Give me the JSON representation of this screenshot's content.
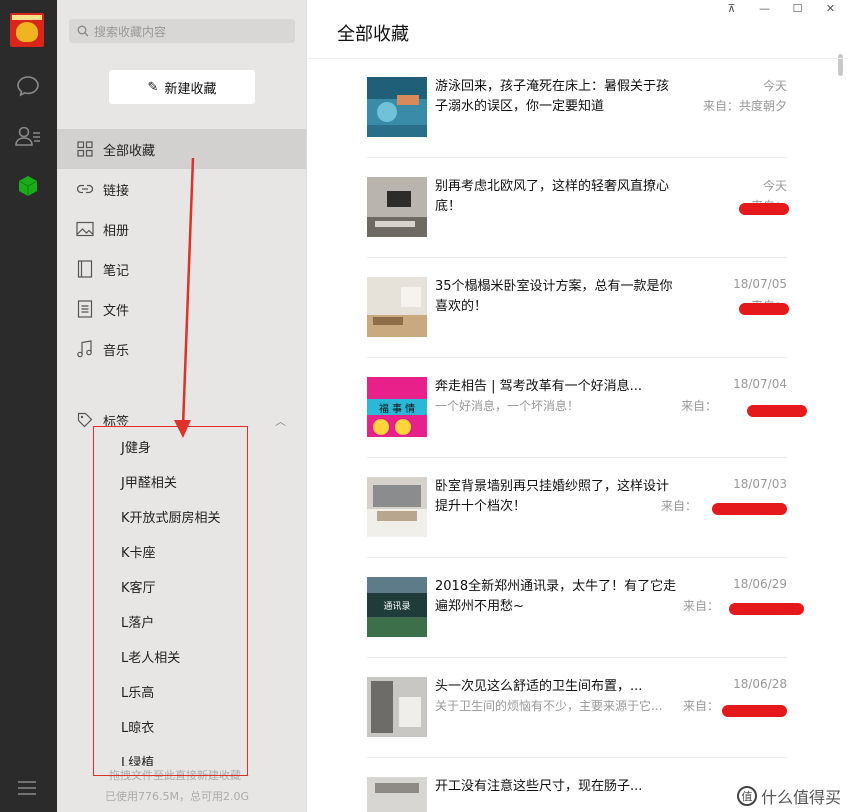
{
  "rail": {
    "icons": [
      "avatar",
      "chat-icon",
      "contacts-icon",
      "favorites-cube-icon",
      "menu-icon"
    ]
  },
  "sidebar": {
    "search_placeholder": "搜索收藏内容",
    "new_button": "新建收藏",
    "items": [
      {
        "label": "全部收藏",
        "icon": "grid-icon"
      },
      {
        "label": "链接",
        "icon": "link-icon"
      },
      {
        "label": "相册",
        "icon": "image-icon"
      },
      {
        "label": "笔记",
        "icon": "note-icon"
      },
      {
        "label": "文件",
        "icon": "file-icon"
      },
      {
        "label": "音乐",
        "icon": "music-icon"
      }
    ],
    "tags_label": "标签",
    "tags": [
      "J健身",
      "J甲醛相关",
      "K开放式厨房相关",
      "K卡座",
      "K客厅",
      "L落户",
      "L老人相关",
      "L乐高",
      "L晾衣",
      "L绿植"
    ],
    "footer_hint": "拖拽文件至此直接新建收藏",
    "footer_usage": "已使用776.5M，总可用2.0G"
  },
  "window": {
    "controls": [
      "pin",
      "minimize",
      "maximize",
      "close"
    ]
  },
  "main": {
    "title": "全部收藏",
    "items": [
      {
        "title": "游泳回来，孩子淹死在床上：暑假关于孩子溺水的误区，你一定要知道",
        "subtitle": "",
        "date": "今天",
        "source": "来自：共度朝夕"
      },
      {
        "title": "别再考虑北欧风了，这样的轻奢风直撩心底！",
        "subtitle": "",
        "date": "今天",
        "source": "来自："
      },
      {
        "title": "35个榻榻米卧室设计方案，总有一款是你喜欢的！",
        "subtitle": "",
        "date": "18/07/05",
        "source": "来自："
      },
      {
        "title": "奔走相告 | 驾考改革有一个好消息...",
        "subtitle": "一个好消息，一个坏消息！",
        "date": "18/07/04",
        "source": "来自："
      },
      {
        "title": "卧室背景墙别再只挂婚纱照了，这样设计提升十个档次！",
        "subtitle": "",
        "date": "18/07/03",
        "source": "来自："
      },
      {
        "title": "2018全新郑州通讯录，太牛了！有了它走遍郑州不用愁~",
        "subtitle": "",
        "date": "18/06/29",
        "source": "来自："
      },
      {
        "title": "头一次见这么舒适的卫生间布置，...",
        "subtitle": "关于卫生间的烦恼有不少，主要来源于它...",
        "date": "18/06/28",
        "source": "来自："
      },
      {
        "title": "开工没有注意这些尺寸，现在肠子...",
        "subtitle": "",
        "date": "",
        "source": ""
      }
    ],
    "thumb_texts": [
      "",
      "",
      "",
      "福 事 情",
      "",
      "通讯录",
      "",
      ""
    ]
  },
  "watermark": {
    "badge": "值",
    "text": "什么值得买"
  },
  "colors": {
    "annotation": "#e0302a",
    "rail_bg": "#2b2b2b",
    "sidebar_bg": "#e8e6e5",
    "favorites_green": "#1aad19"
  }
}
